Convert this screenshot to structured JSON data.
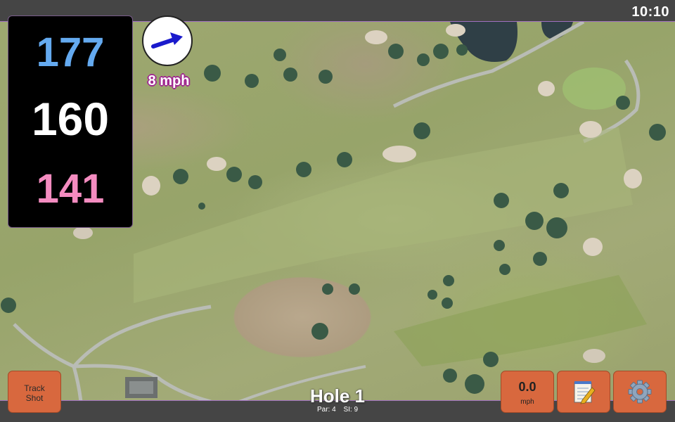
{
  "status": {
    "time": "10:10"
  },
  "distances": {
    "back": "177",
    "middle": "160",
    "front": "141"
  },
  "wind": {
    "label": "8 mph",
    "direction_icon": "arrow-icon",
    "arrow_color": "#1a1acc"
  },
  "buttons": {
    "track_shot": {
      "line1": "Track",
      "line2": "Shot"
    },
    "wind_speed": {
      "value": "0.0",
      "unit": "mph"
    },
    "notes": {
      "icon": "notepad-icon"
    },
    "settings": {
      "icon": "gear-icon"
    }
  },
  "hole": {
    "title": "Hole 1",
    "par": "Par: 4",
    "si": "SI: 9"
  },
  "colors": {
    "back": "#64aaf0",
    "middle": "#ffffff",
    "front": "#f48cc0",
    "button": "#d8683e",
    "wind_text_outline": "#a02890"
  }
}
